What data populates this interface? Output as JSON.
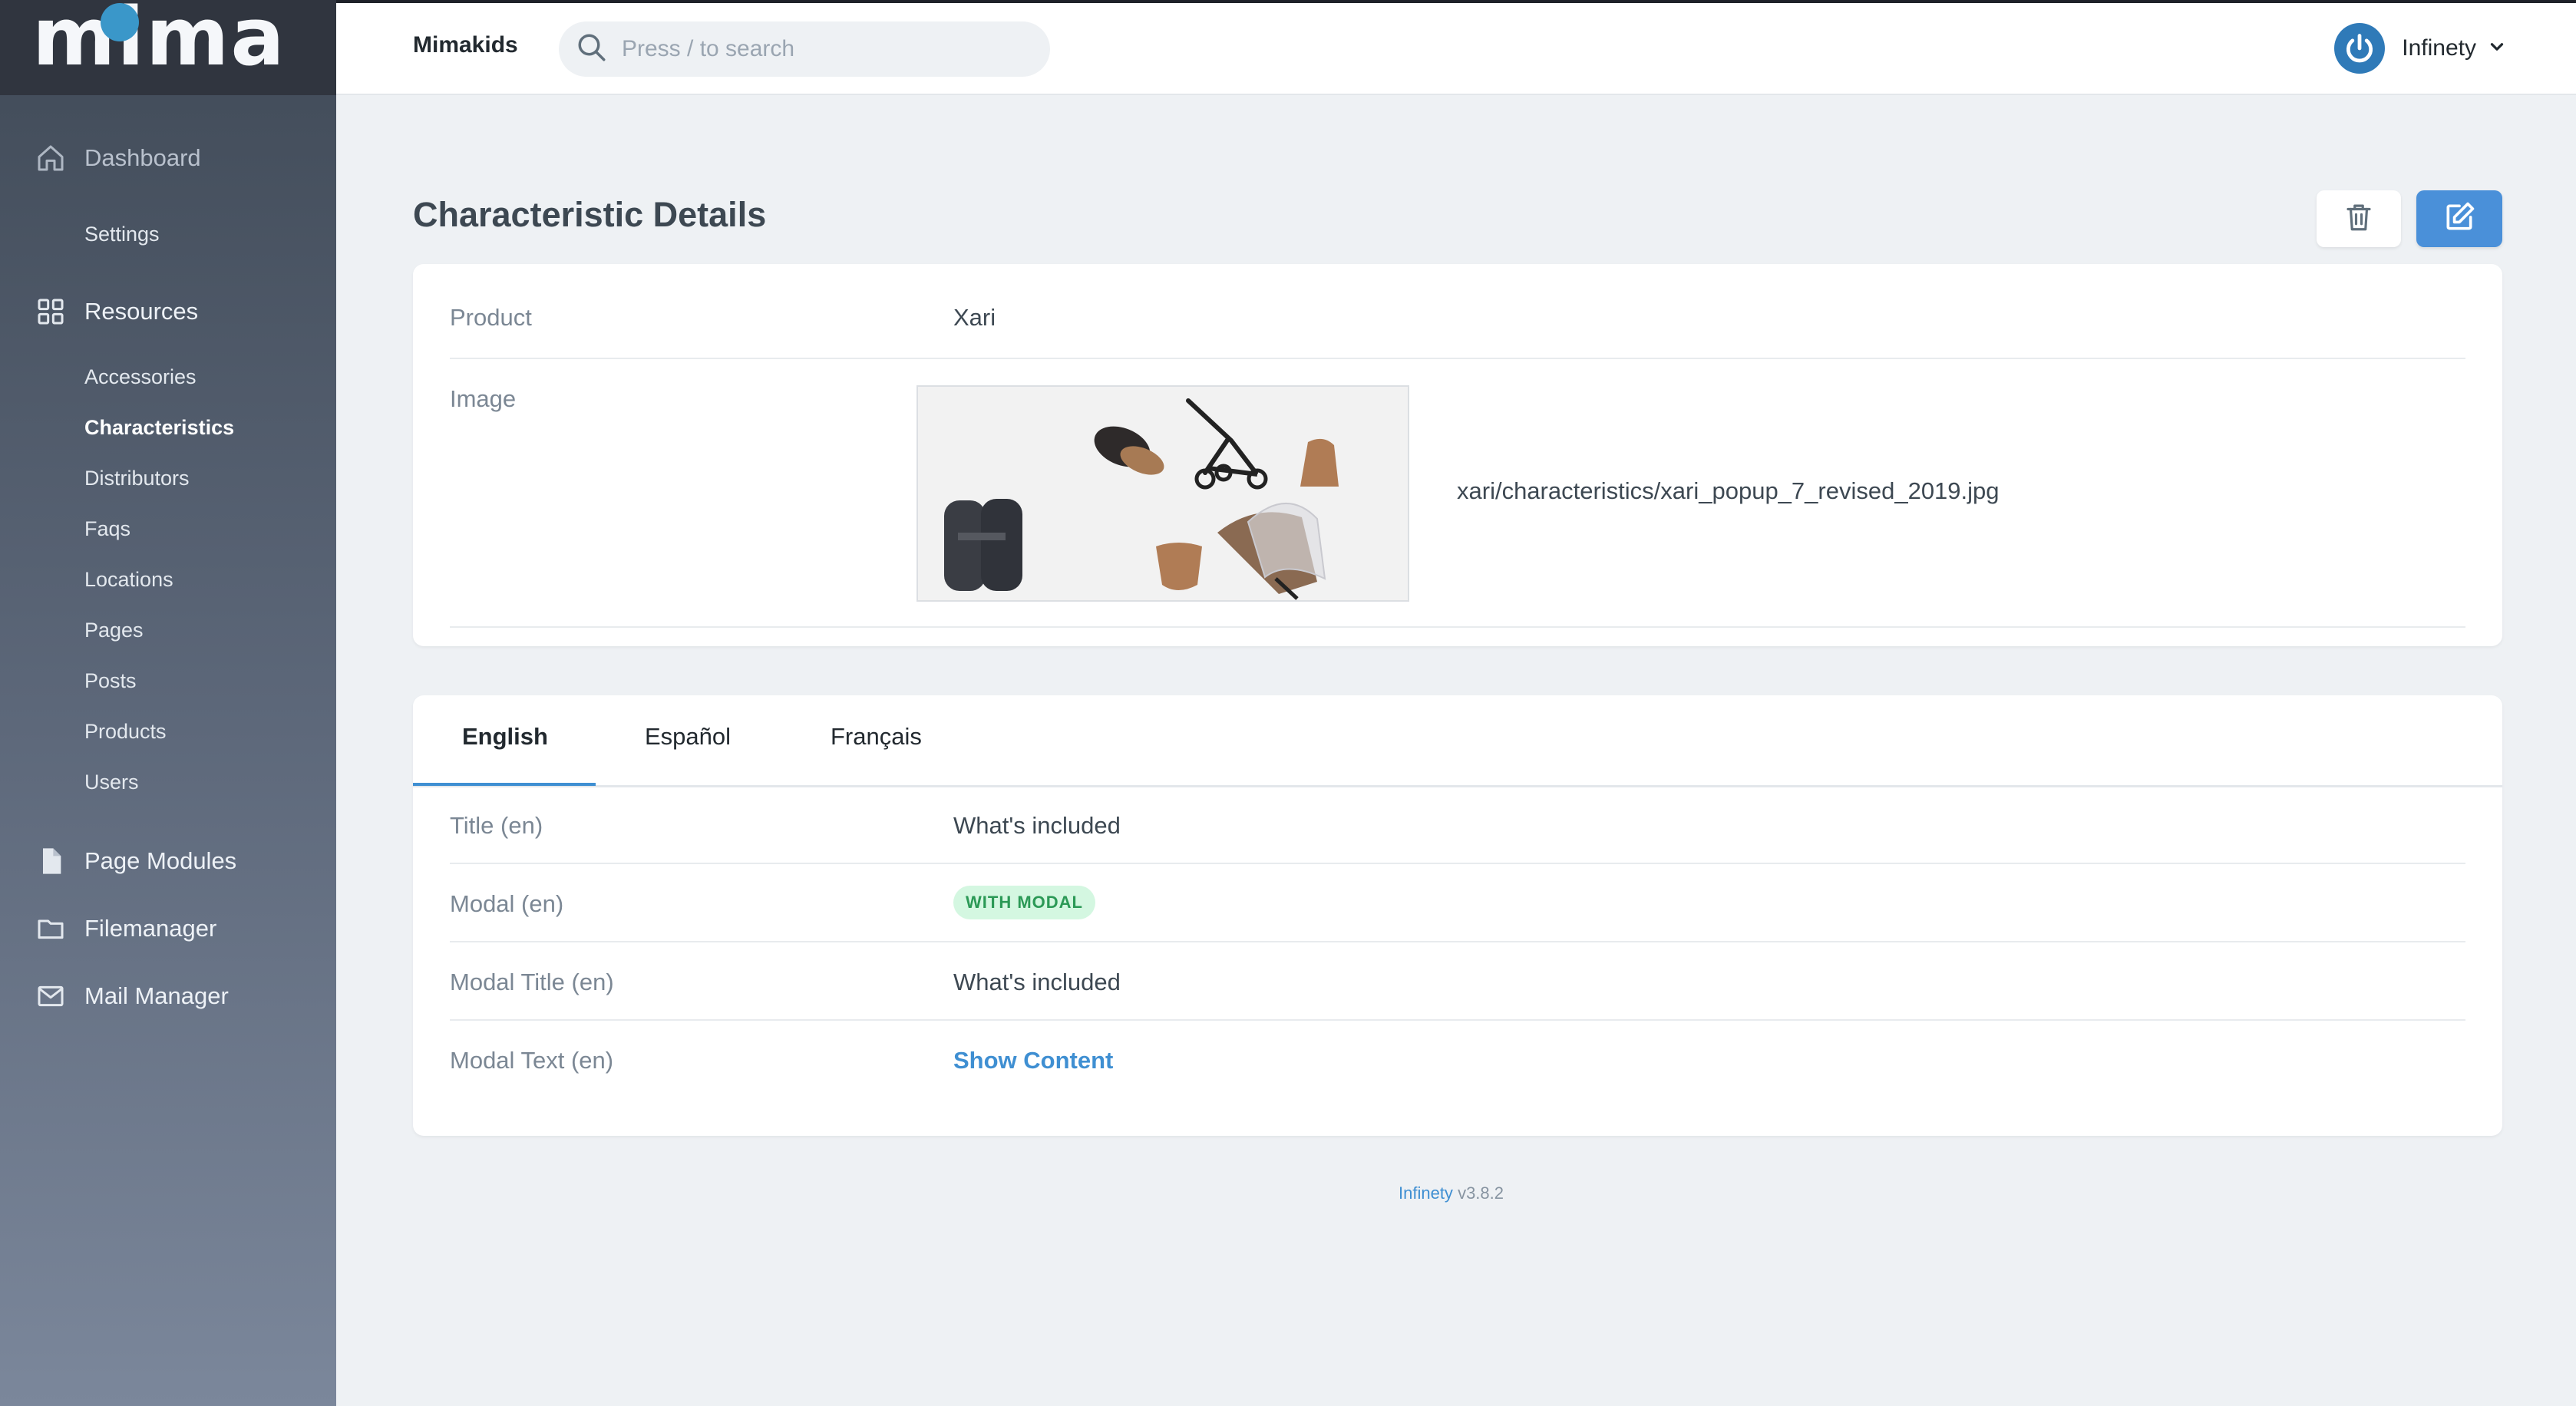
{
  "sidebar": {
    "logo": "mima",
    "dashboard": "Dashboard",
    "settings": "Settings",
    "resources": "Resources",
    "resource_items": [
      "Accessories",
      "Characteristics",
      "Distributors",
      "Faqs",
      "Locations",
      "Pages",
      "Posts",
      "Products",
      "Users"
    ],
    "active_item": "Characteristics",
    "page_modules": "Page Modules",
    "filemanager": "Filemanager",
    "mail_manager": "Mail Manager"
  },
  "header": {
    "brand": "Mimakids",
    "search_placeholder": "Press / to search",
    "user_name": "Infinety"
  },
  "page": {
    "title": "Characteristic Details"
  },
  "details": {
    "product_label": "Product",
    "product_value": "Xari",
    "image_label": "Image",
    "image_path": "xari/characteristics/xari_popup_7_revised_2019.jpg"
  },
  "tabs": [
    "English",
    "Español",
    "Français"
  ],
  "active_tab": "English",
  "translations": {
    "title_label": "Title (en)",
    "title_value": "What's included",
    "modal_label": "Modal (en)",
    "modal_badge": "WITH MODAL",
    "modal_title_label": "Modal Title (en)",
    "modal_title_value": "What's included",
    "modal_text_label": "Modal Text (en)",
    "modal_text_link": "Show Content"
  },
  "footer": {
    "name": "Infinety",
    "version": "v3.8.2"
  },
  "colors": {
    "accent": "#4a90d9",
    "badge_bg": "#d4f7e1",
    "badge_text": "#2b9956"
  }
}
